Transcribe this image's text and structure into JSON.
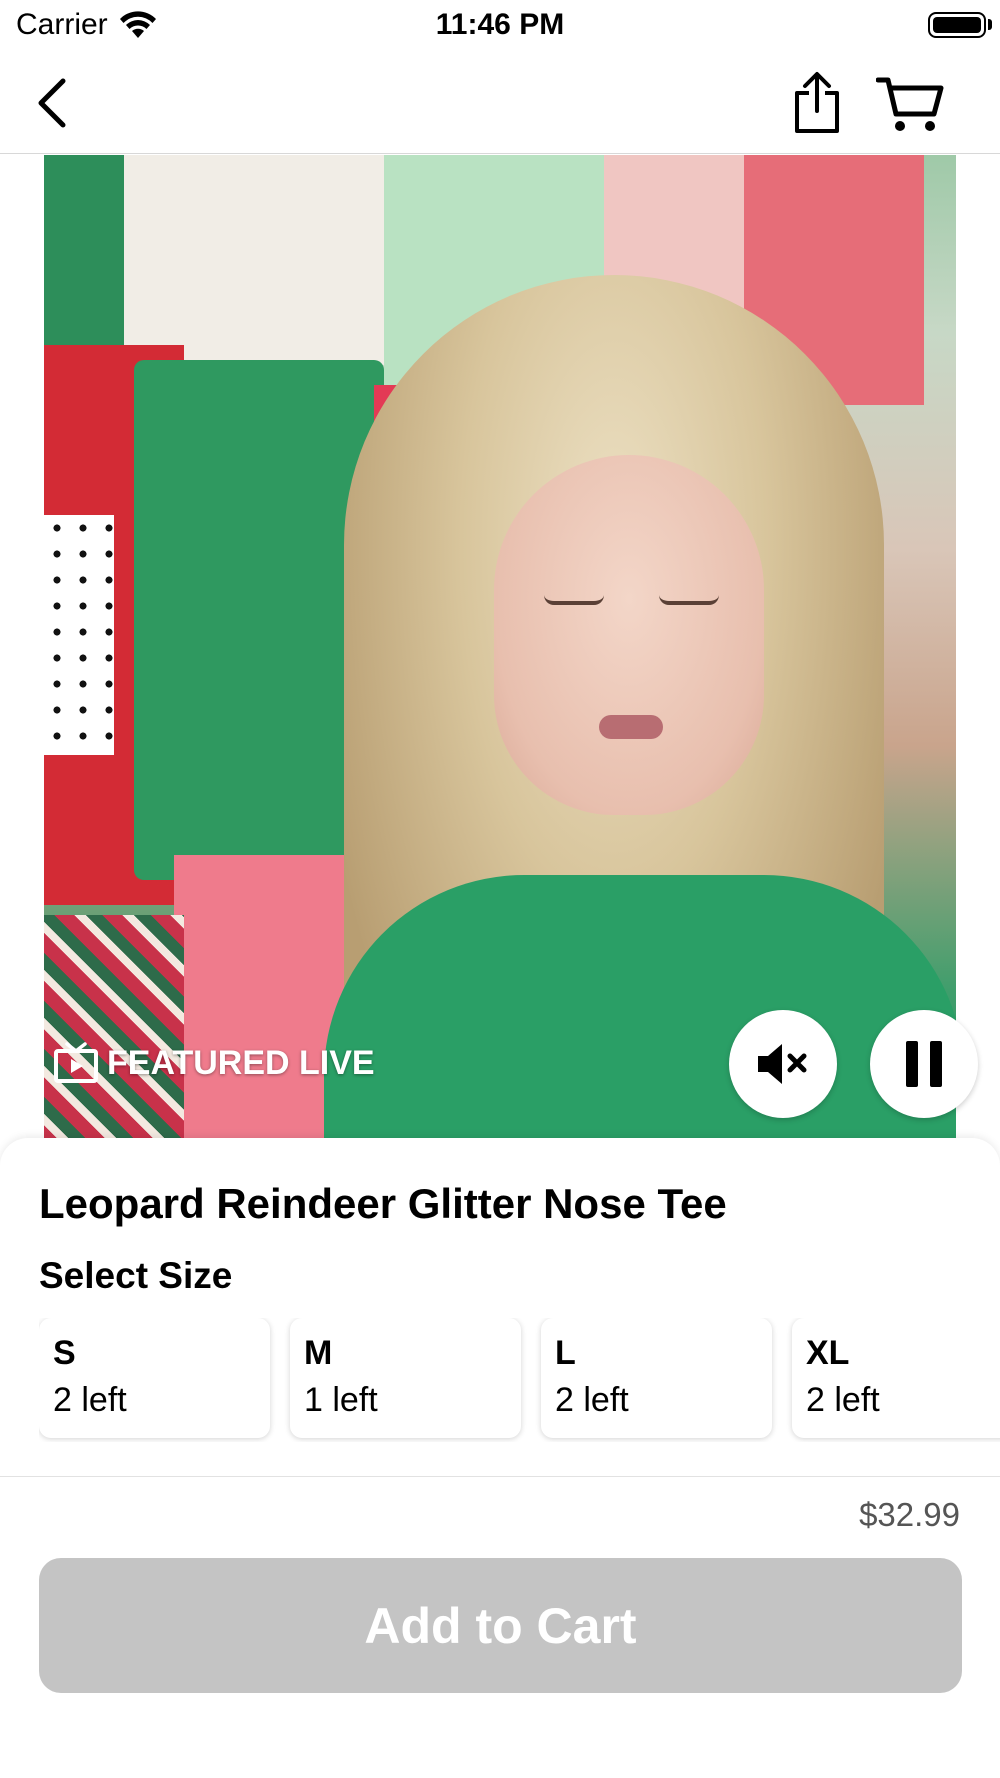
{
  "status_bar": {
    "carrier": "Carrier",
    "time": "11:46 PM"
  },
  "nav": {
    "back_icon": "chevron-left-icon",
    "share_icon": "share-icon",
    "cart_icon": "cart-icon"
  },
  "video": {
    "badge_icon": "tv-icon",
    "badge_label": "FEATURED LIVE",
    "mute_icon": "mute-icon",
    "pause_icon": "pause-icon"
  },
  "product": {
    "title": "Leopard Reindeer Glitter Nose Tee",
    "size_heading": "Select Size",
    "sizes": [
      {
        "label": "S",
        "stock": "2 left"
      },
      {
        "label": "M",
        "stock": "1 left"
      },
      {
        "label": "L",
        "stock": "2 left"
      },
      {
        "label": "XL",
        "stock": "2 left"
      }
    ],
    "price": "$32.99",
    "add_to_cart_label": "Add to Cart"
  },
  "colors": {
    "button_disabled": "#c4c4c4",
    "price_text": "#555555"
  }
}
